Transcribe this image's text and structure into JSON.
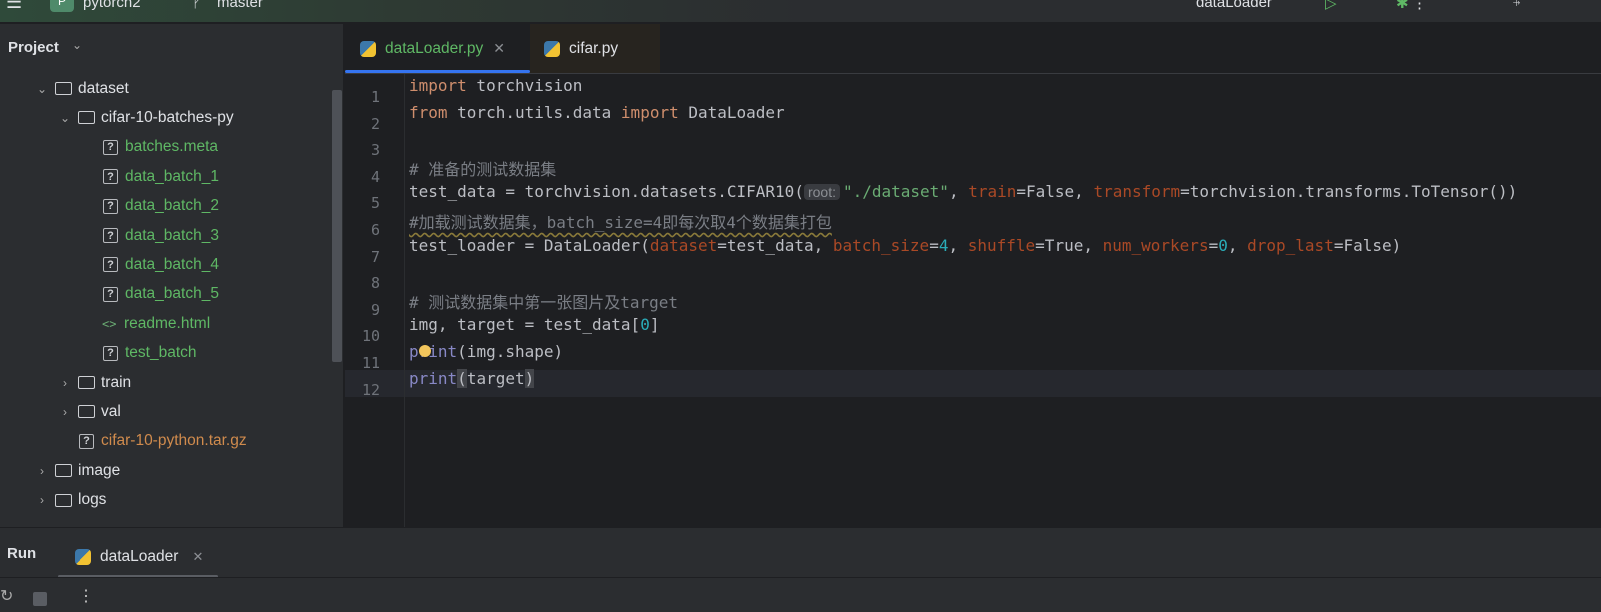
{
  "topbar": {
    "project": "pytorch2",
    "project_initial": "P",
    "branch": "master",
    "run_config": "dataLoader"
  },
  "sidebar": {
    "title": "Project",
    "tree": [
      {
        "label": "dataset",
        "depth": 1,
        "type": "folder",
        "open": true,
        "color": "#dfe1e5"
      },
      {
        "label": "cifar-10-batches-py",
        "depth": 2,
        "type": "folder",
        "open": true,
        "color": "#dfe1e5"
      },
      {
        "label": "batches.meta",
        "depth": 3,
        "type": "unknown",
        "color": "#5fb865"
      },
      {
        "label": "data_batch_1",
        "depth": 3,
        "type": "unknown",
        "color": "#5fb865"
      },
      {
        "label": "data_batch_2",
        "depth": 3,
        "type": "unknown",
        "color": "#5fb865"
      },
      {
        "label": "data_batch_3",
        "depth": 3,
        "type": "unknown",
        "color": "#5fb865"
      },
      {
        "label": "data_batch_4",
        "depth": 3,
        "type": "unknown",
        "color": "#5fb865"
      },
      {
        "label": "data_batch_5",
        "depth": 3,
        "type": "unknown",
        "color": "#5fb865"
      },
      {
        "label": "readme.html",
        "depth": 3,
        "type": "html",
        "color": "#5fb865"
      },
      {
        "label": "test_batch",
        "depth": 3,
        "type": "unknown",
        "color": "#5fb865"
      },
      {
        "label": "train",
        "depth": 2,
        "type": "folder",
        "open": false,
        "color": "#dfe1e5"
      },
      {
        "label": "val",
        "depth": 2,
        "type": "folder",
        "open": false,
        "color": "#dfe1e5"
      },
      {
        "label": "cifar-10-python.tar.gz",
        "depth": 2,
        "type": "unknown-file",
        "color": "#d08b4d"
      },
      {
        "label": "image",
        "depth": 1,
        "type": "folder",
        "open": false,
        "color": "#dfe1e5"
      },
      {
        "label": "logs",
        "depth": 1,
        "type": "folder",
        "open": false,
        "color": "#dfe1e5"
      }
    ]
  },
  "tabs": [
    {
      "label": "dataLoader.py",
      "active": true,
      "color": "#5fb865"
    },
    {
      "label": "cifar.py",
      "active": false,
      "color": "#dfe1e5"
    }
  ],
  "editor": {
    "lines": [
      [
        [
          "import",
          "kw"
        ],
        [
          " torchvision",
          ""
        ]
      ],
      [
        [
          "from",
          "kw"
        ],
        [
          " torch.utils.data ",
          ""
        ],
        [
          "import",
          "kw"
        ],
        [
          " DataLoader",
          ""
        ]
      ],
      [],
      [
        [
          "# 准备的测试数据集",
          "cm"
        ]
      ],
      [
        [
          "test_data = torchvision.datasets.CIFAR10(",
          ""
        ],
        [
          "root:",
          "hint"
        ],
        [
          "\"./dataset\"",
          "str"
        ],
        [
          ", ",
          ""
        ],
        [
          "train",
          "pa"
        ],
        [
          "=False, ",
          ""
        ],
        [
          "transform",
          "pa"
        ],
        [
          "=torchvision.transforms.ToTensor())",
          ""
        ]
      ],
      [
        [
          "#加载测试数据集，batch_size=4即每次取4个数据集打包",
          "cm warn"
        ]
      ],
      [
        [
          "test_loader = DataLoader(",
          ""
        ],
        [
          "dataset",
          "pa"
        ],
        [
          "=test_data, ",
          ""
        ],
        [
          "batch_size",
          "pa"
        ],
        [
          "=",
          ""
        ],
        [
          "4",
          "num"
        ],
        [
          ", ",
          ""
        ],
        [
          "shuffle",
          "pa"
        ],
        [
          "=True, ",
          ""
        ],
        [
          "num_workers",
          "pa"
        ],
        [
          "=",
          ""
        ],
        [
          "0",
          "num"
        ],
        [
          ", ",
          ""
        ],
        [
          "drop_last",
          "pa"
        ],
        [
          "=False)",
          ""
        ]
      ],
      [],
      [
        [
          "# 测试数据集中第一张图片及target",
          "cm"
        ]
      ],
      [
        [
          "img, target = test_data[",
          ""
        ],
        [
          "0",
          "num"
        ],
        [
          "]",
          ""
        ]
      ],
      [
        [
          "print",
          "bi"
        ],
        [
          "(img.shape)",
          ""
        ]
      ],
      [
        [
          "print",
          "bi"
        ],
        [
          "(",
          "br"
        ],
        [
          "target",
          ""
        ],
        [
          ")",
          "br"
        ]
      ]
    ]
  },
  "bottom": {
    "title": "Run",
    "tab": "dataLoader"
  }
}
